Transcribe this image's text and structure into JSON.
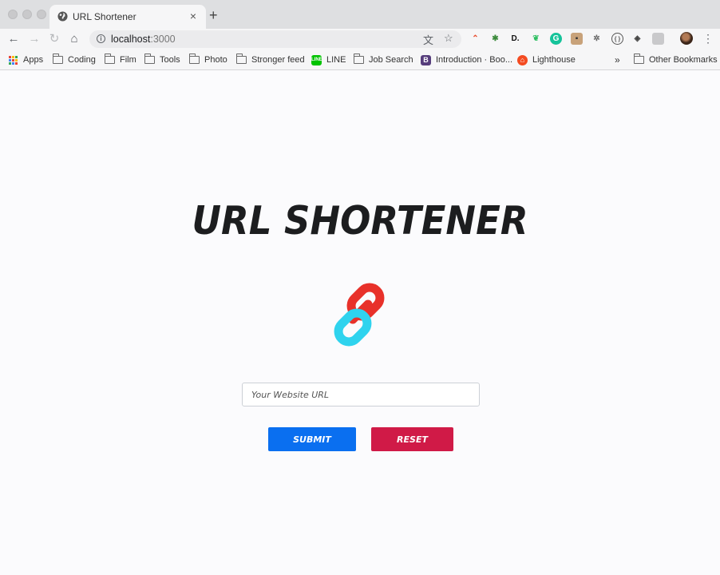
{
  "browser": {
    "tab": {
      "title": "URL Shortener",
      "close": "×"
    },
    "new_tab": "+",
    "address": {
      "host": "localhost",
      "port": ":3000"
    },
    "nav": {
      "back": "←",
      "forward": "→",
      "reload": "↻",
      "home": "⌂"
    },
    "menu": "⋮",
    "overflow": "»"
  },
  "bookmarks": [
    {
      "label": "Apps",
      "icon": "apps-grid-icon"
    },
    {
      "label": "Coding",
      "icon": "folder-icon"
    },
    {
      "label": "Film",
      "icon": "folder-icon"
    },
    {
      "label": "Tools",
      "icon": "folder-icon"
    },
    {
      "label": "Photo",
      "icon": "folder-icon"
    },
    {
      "label": "Stronger feed",
      "icon": "folder-icon"
    },
    {
      "label": "LINE",
      "icon": "line-icon"
    },
    {
      "label": "Job Search",
      "icon": "folder-icon"
    },
    {
      "label": "Introduction · Boo...",
      "icon": "bootstrap-icon"
    },
    {
      "label": "Lighthouse",
      "icon": "lighthouse-icon"
    },
    {
      "label": "Other Bookmarks",
      "icon": "folder-icon"
    }
  ],
  "app": {
    "title": "URL SHORTENER",
    "input_placeholder": "Your Website URL",
    "input_value": "",
    "submit_label": "SUBMIT",
    "reset_label": "RESET"
  },
  "colors": {
    "submit": "#0a6ff0",
    "reset": "#d01a47",
    "logo_red": "#e8312a",
    "logo_cyan": "#2fd3ee"
  }
}
